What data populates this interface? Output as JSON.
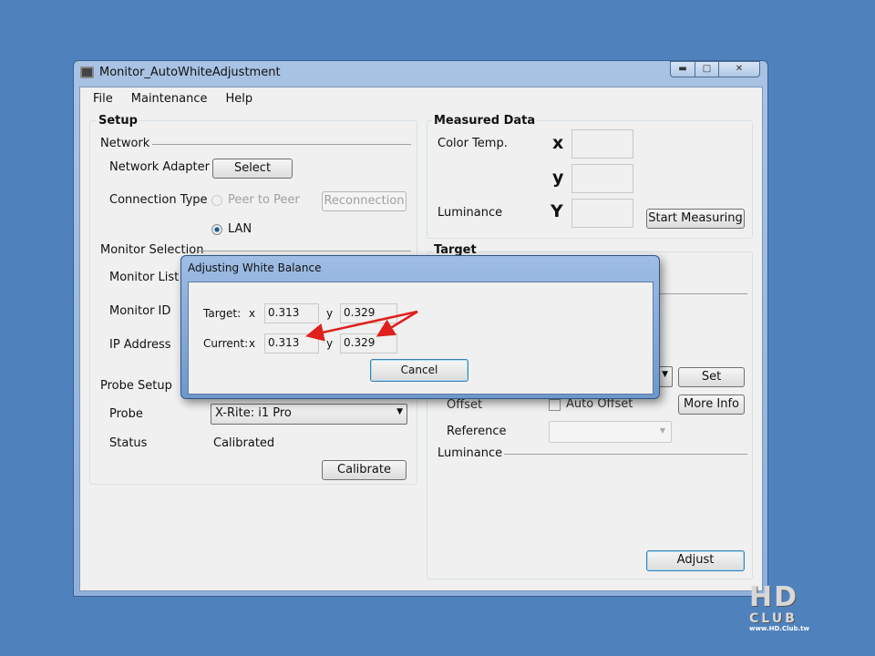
{
  "window": {
    "title": "Monitor_AutoWhiteAdjustment",
    "minimize": "▬",
    "maximize": "□",
    "close": "✕"
  },
  "menu": [
    "File",
    "Maintenance",
    "Help"
  ],
  "setup": {
    "title": "Setup",
    "network": "Network",
    "network_adapter": "Network Adapter",
    "select": "Select",
    "connection_type": "Connection Type",
    "peer_to_peer": "Peer to Peer",
    "reconnection": "Reconnection",
    "lan": "LAN",
    "monitor_selection": "Monitor Selection",
    "monitor_list": "Monitor List",
    "monitor_id": "Monitor ID",
    "ip_address": "IP Address",
    "probe_setup": "Probe Setup",
    "probe": "Probe",
    "probe_value": "X-Rite: i1 Pro",
    "status": "Status",
    "status_value": "Calibrated",
    "calibrate": "Calibrate"
  },
  "measured": {
    "title": "Measured Data",
    "color_temp": "Color Temp.",
    "x": "x",
    "y": "y",
    "luminance": "Luminance",
    "Y": "Y",
    "start": "Start Measuring"
  },
  "target": {
    "title": "Target",
    "set": "Set",
    "offset": "Offset",
    "auto_offset": "Auto Offset",
    "more_info": "More Info",
    "reference": "Reference",
    "luminance": "Luminance",
    "adjust": "Adjust"
  },
  "dialog": {
    "title": "Adjusting White Balance",
    "target_label": "Target:",
    "current_label": "Current:",
    "x": "x",
    "y": "y",
    "target_x": "0.313",
    "target_y": "0.329",
    "current_x": "0.313",
    "current_y": "0.329",
    "cancel": "Cancel",
    "arrow_color": "#e0201c"
  },
  "watermark": {
    "text": "HD CLUB",
    "url": "www.HD.Club.tw"
  }
}
